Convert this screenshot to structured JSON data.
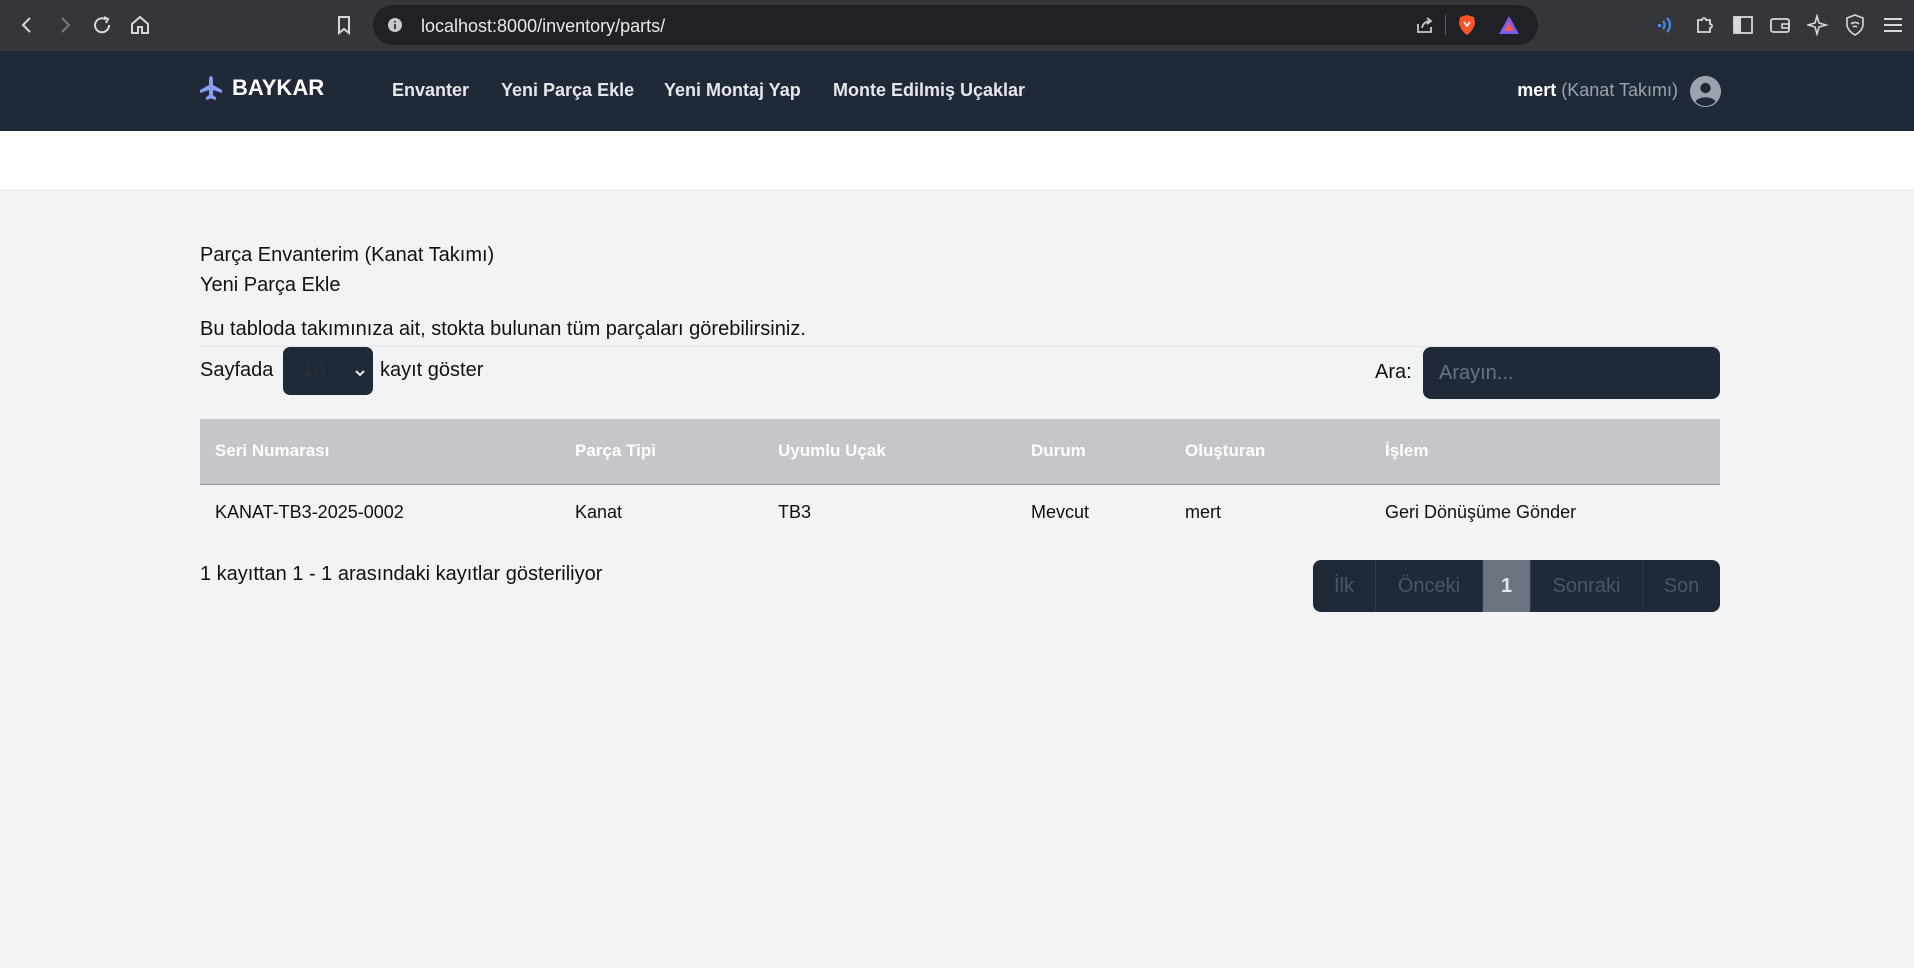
{
  "browser": {
    "url": "localhost:8000/inventory/parts/"
  },
  "nav": {
    "brand": "BAYKAR",
    "links": [
      "Envanter",
      "Yeni Parça Ekle",
      "Yeni Montaj Yap",
      "Monte Edilmiş Uçaklar"
    ],
    "user_name": "mert",
    "user_team": "(Kanat Takımı)"
  },
  "page": {
    "title": "Parça Envanterim (Kanat Takımı)",
    "add_link": "Yeni Parça Ekle",
    "description": "Bu tabloda takımınıza ait, stokta bulunan tüm parçaları görebilirsiniz."
  },
  "controls": {
    "length_prefix": "Sayfada",
    "length_value": "10",
    "length_suffix": "kayıt göster",
    "search_label": "Ara:",
    "search_placeholder": "Arayın..."
  },
  "table": {
    "headers": [
      "Seri Numarası",
      "Parça Tipi",
      "Uyumlu Uçak",
      "Durum",
      "Oluşturan",
      "İşlem"
    ],
    "rows": [
      [
        "KANAT-TB3-2025-0002",
        "Kanat",
        "TB3",
        "Mevcut",
        "mert",
        "Geri Dönüşüme Gönder"
      ]
    ]
  },
  "footer": {
    "info": "1 kayıttan 1 - 1 arasındaki kayıtlar gösteriliyor",
    "pager": [
      "İlk",
      "Önceki",
      "1",
      "Sonraki",
      "Son"
    ]
  },
  "colors": {
    "nav_bg": "#1f2937",
    "brand_icon": "#8b9cf7",
    "table_header_bg": "#c4c6cb",
    "page_bg": "#f2f3f5"
  }
}
